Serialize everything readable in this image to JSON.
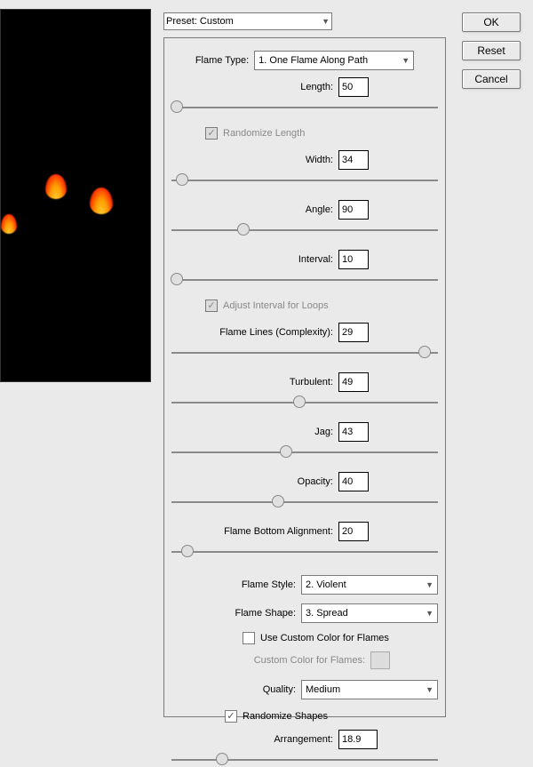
{
  "preset": {
    "value": "Preset: Custom"
  },
  "buttons": {
    "ok": "OK",
    "reset": "Reset",
    "cancel": "Cancel"
  },
  "labels": {
    "flame_type": "Flame Type:",
    "length": "Length:",
    "randomize_length": "Randomize Length",
    "width": "Width:",
    "angle": "Angle:",
    "interval": "Interval:",
    "adjust_interval": "Adjust Interval for Loops",
    "complexity": "Flame Lines (Complexity):",
    "turbulent": "Turbulent:",
    "jag": "Jag:",
    "opacity": "Opacity:",
    "bottom_align": "Flame Bottom Alignment:",
    "flame_style": "Flame Style:",
    "flame_shape": "Flame Shape:",
    "use_custom_color": "Use Custom Color for Flames",
    "custom_color": "Custom Color for Flames:",
    "quality": "Quality:",
    "randomize_shapes": "Randomize Shapes",
    "arrangement": "Arrangement:"
  },
  "values": {
    "flame_type": "1. One Flame Along Path",
    "length": "50",
    "width": "34",
    "angle": "90",
    "interval": "10",
    "complexity": "29",
    "turbulent": "49",
    "jag": "43",
    "opacity": "40",
    "bottom_align": "20",
    "flame_style": "2. Violent",
    "flame_shape": "3. Spread",
    "quality": "Medium",
    "arrangement": "18.9"
  },
  "sliders": {
    "length": 2,
    "width": 4,
    "angle": 27,
    "interval": 2,
    "complexity": 95,
    "turbulent": 48,
    "jag": 43,
    "opacity": 40,
    "bottom_align": 6,
    "arrangement": 19
  }
}
